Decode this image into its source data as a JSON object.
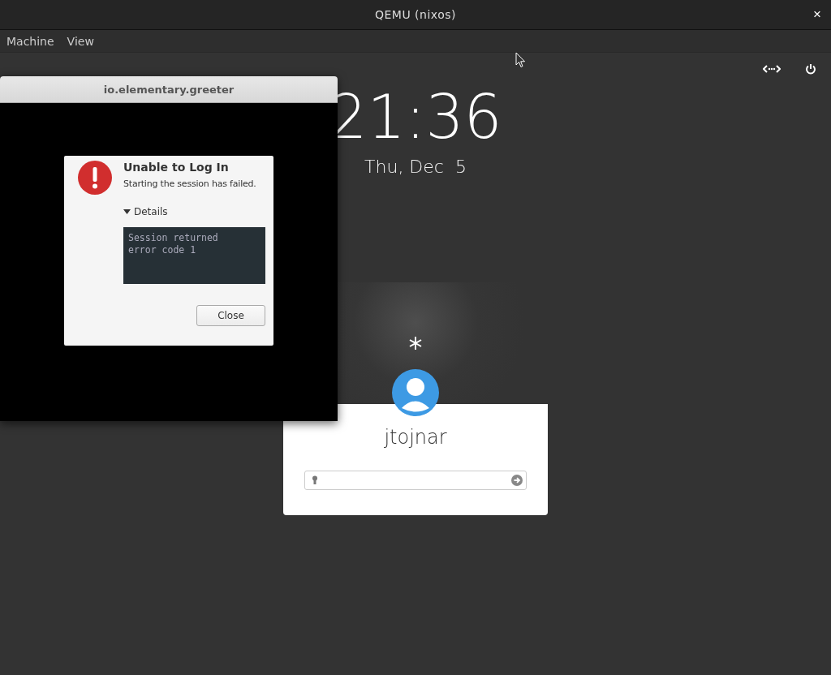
{
  "window": {
    "title": "QEMU (nixos)",
    "close": "×"
  },
  "menu": [
    {
      "label": "Machine"
    },
    {
      "label": "View"
    }
  ],
  "greeter": {
    "time": "21:36",
    "date": "Thu, Dec  5",
    "user": {
      "name": "jtojnar"
    }
  },
  "dialog_window": {
    "title": "io.elementary.greeter",
    "heading": "Unable to Log In",
    "message": "Starting the session has failed.",
    "details": {
      "label": "Details",
      "expanded": true,
      "text": [
        "Session returned",
        "error code 1"
      ]
    },
    "buttons": [
      {
        "label": "Close"
      }
    ]
  }
}
